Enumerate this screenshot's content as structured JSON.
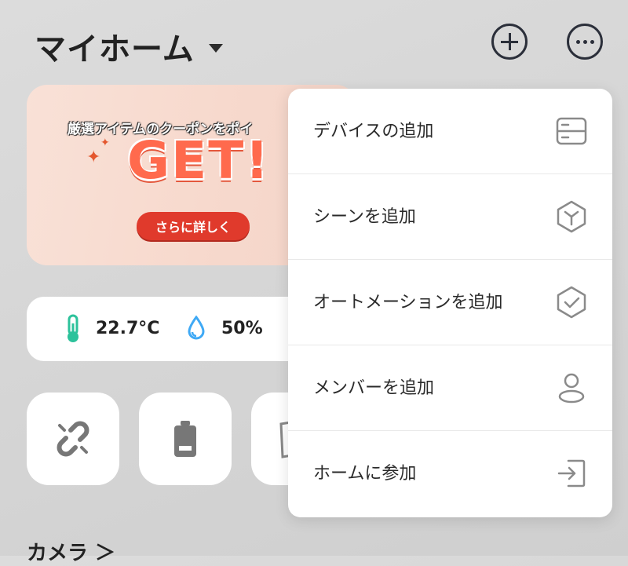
{
  "header": {
    "home_title": "マイホーム",
    "add_icon": "plus-circle-icon",
    "more_icon": "more-horizontal-icon"
  },
  "banner": {
    "headline": "厳選アイテムのクーポンをポイ",
    "big_text": "GET!",
    "cta_label": "さらに詳しく"
  },
  "weather": {
    "temperature": "22.7°C",
    "humidity": "50%"
  },
  "tiles": [
    {
      "icon": "broken-link-icon"
    },
    {
      "icon": "battery-icon"
    },
    {
      "icon": "device-icon"
    }
  ],
  "sections": {
    "camera": "カメラ ＞"
  },
  "menu": {
    "items": [
      {
        "label": "デバイスの追加",
        "icon": "device-list-icon"
      },
      {
        "label": "シーンを追加",
        "icon": "scene-hexagon-icon"
      },
      {
        "label": "オートメーションを追加",
        "icon": "automation-check-icon"
      },
      {
        "label": "メンバーを追加",
        "icon": "person-icon"
      },
      {
        "label": "ホームに参加",
        "icon": "join-enter-icon"
      }
    ]
  },
  "colors": {
    "accent_red": "#e03a2c",
    "thermo_teal": "#2cc29b",
    "drop_blue": "#3fa9f5"
  }
}
